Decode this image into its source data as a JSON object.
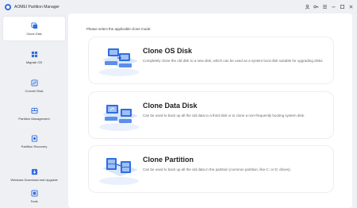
{
  "app": {
    "title": "AOMEI Partition Manager"
  },
  "titlebar_icons": [
    "user-icon",
    "key-icon",
    "menu-icon",
    "minimize-icon",
    "maximize-icon",
    "close-icon"
  ],
  "sidebar": {
    "items": [
      {
        "label": "Clone Disk",
        "icon": "clone-disk-icon",
        "active": true
      },
      {
        "label": "Migrate OS",
        "icon": "migrate-os-icon",
        "active": false
      },
      {
        "label": "Convert Disk",
        "icon": "convert-disk-icon",
        "active": false
      },
      {
        "label": "Partition Management",
        "icon": "partition-management-icon",
        "active": false
      },
      {
        "label": "Partition Recovery",
        "icon": "partition-recovery-icon",
        "active": false
      },
      {
        "label": "Windows Download and Upgrade",
        "icon": "windows-download-icon",
        "active": false
      },
      {
        "label": "Tools",
        "icon": "tools-icon",
        "active": false
      }
    ]
  },
  "main": {
    "heading": "Please select the applicable clone mode:",
    "options": [
      {
        "title": "Clone OS Disk",
        "description": "Completely clone the old disk to a new disk, which can be used as a system boot disk suitable for upgrading disks."
      },
      {
        "title": "Clone Data Disk",
        "description": "Can be used to back up all the old data to a third disk or to clone a non-frequently booting system disk."
      },
      {
        "title": "Clone Partition",
        "description": "Can be used to back up all the old data in the partition (common partition, like C: or D: drives)."
      }
    ]
  },
  "colors": {
    "accent": "#2f6de1",
    "illustration_light": "#cfe0fb"
  }
}
